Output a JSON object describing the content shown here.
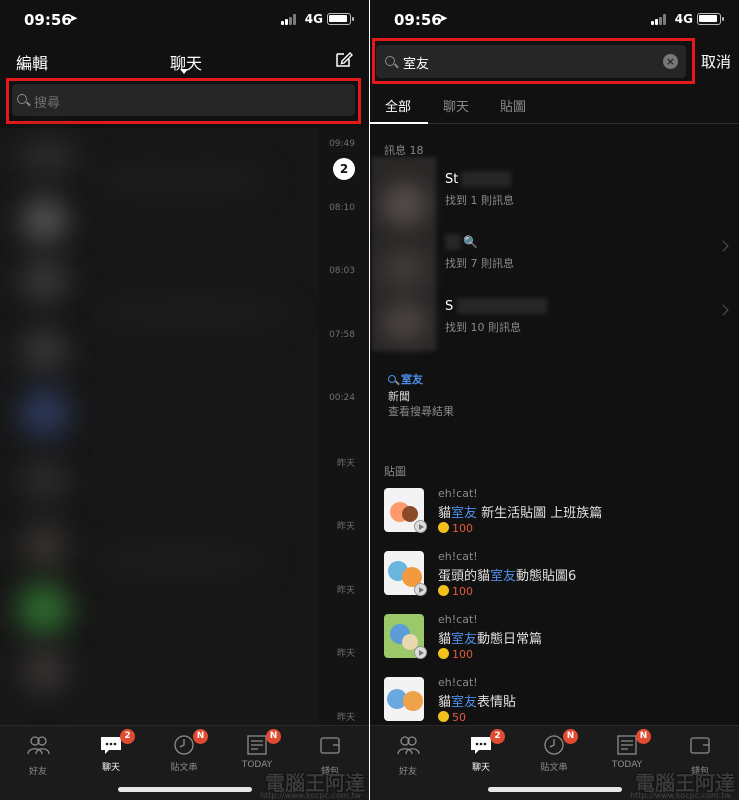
{
  "colors": {
    "highlight_box": "#e3191b",
    "accent_blue": "#4d8ee8",
    "badge_red": "#e14b31",
    "price_red": "#e35b3c",
    "background": "#111111"
  },
  "status_bar": {
    "time": "09:56",
    "network": "4G"
  },
  "left": {
    "header": {
      "edit_label": "編輯",
      "title": "聊天"
    },
    "search": {
      "placeholder": "搜尋"
    },
    "times": [
      "09:49",
      "08:10",
      "08:03",
      "07:58",
      "00:24",
      "昨天",
      "昨天",
      "昨天",
      "昨天",
      "昨天"
    ],
    "unread_count": "2"
  },
  "tabbar": {
    "items": [
      {
        "label": "好友",
        "badge": ""
      },
      {
        "label": "聊天",
        "badge": "2"
      },
      {
        "label": "貼文串",
        "badge": "N"
      },
      {
        "label": "TODAY",
        "badge": "N"
      },
      {
        "label": "錢包",
        "badge": ""
      }
    ]
  },
  "right": {
    "search": {
      "query": "室友",
      "cancel_label": "取消"
    },
    "filter_tabs": [
      "全部",
      "聊天",
      "貼圖"
    ],
    "messages_label": "訊息 18",
    "messages": [
      {
        "name": "St",
        "sub": "找到 1 則訊息"
      },
      {
        "name": "🔍",
        "sub": "找到 7 則訊息"
      },
      {
        "name": "S",
        "sub": "找到 10 則訊息"
      }
    ],
    "news": {
      "query": "室友",
      "title": "新聞",
      "sub": "查看搜尋結果"
    },
    "stickers_label": "貼圖",
    "stickers": [
      {
        "author": "eh!cat!",
        "pre": "貓",
        "hl": "室友",
        "post": " 新生活貼圖 上班族篇",
        "price": "100"
      },
      {
        "author": "eh!cat!",
        "pre": "蛋頭的貓",
        "hl": "室友",
        "post": "動態貼圖6",
        "price": "100"
      },
      {
        "author": "eh!cat!",
        "pre": "貓",
        "hl": "室友",
        "post": "動態日常篇",
        "price": "100"
      },
      {
        "author": "eh!cat!",
        "pre": "貓",
        "hl": "室友",
        "post": "表情貼",
        "price": "50"
      }
    ]
  },
  "watermark": {
    "text": "電腦王阿達",
    "url": "http://www.kocpc.com.tw"
  }
}
